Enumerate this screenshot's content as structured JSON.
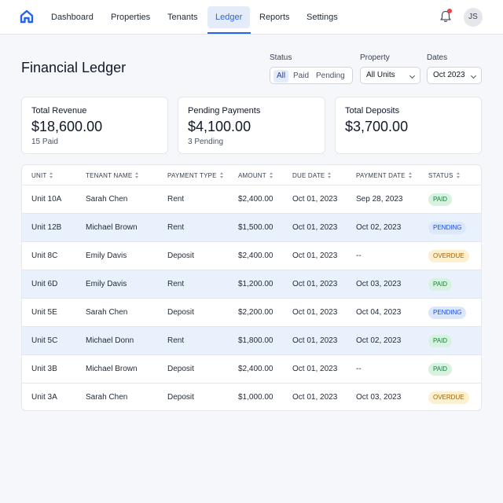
{
  "nav": {
    "items": [
      "Dashboard",
      "Properties",
      "Tenants",
      "Ledger",
      "Reports",
      "Settings"
    ],
    "active": "Ledger",
    "avatar_initials": "JS",
    "accent_color": "#2563eb",
    "icons": [
      "home-logo-icon",
      "bell-icon"
    ]
  },
  "page": {
    "title": "Financial Ledger"
  },
  "filters": {
    "status_label": "Status",
    "status_options": [
      "All",
      "Paid",
      "Pending"
    ],
    "status_selected": "All",
    "property_label": "Property",
    "property_value": "All Units",
    "dates_label": "Dates",
    "dates_value": "Oct 2023"
  },
  "cards": [
    {
      "title": "Total Revenue",
      "value": "$18,600.00",
      "sub": "15 Paid"
    },
    {
      "title": "Pending Payments",
      "value": "$4,100.00",
      "sub": "3 Pending"
    },
    {
      "title": "Total Deposits",
      "value": "$3,700.00",
      "sub": ""
    }
  ],
  "table": {
    "columns": [
      "Unit",
      "Tenant Name",
      "Payment Type",
      "Amount",
      "Due Date",
      "Payment Date",
      "Status"
    ],
    "rows": [
      {
        "unit": "Unit 10A",
        "tenant": "Sarah Chen",
        "type": "Rent",
        "amount": "$2,400.00",
        "due": "Oct 01, 2023",
        "paid": "Sep 28, 2023",
        "status": "PAID",
        "status_kind": "paid"
      },
      {
        "unit": "Unit 12B",
        "tenant": "Michael Brown",
        "type": "Rent",
        "amount": "$1,500.00",
        "due": "Oct 01, 2023",
        "paid": "Oct 02, 2023",
        "status": "PENDING",
        "status_kind": "pending"
      },
      {
        "unit": "Unit 8C",
        "tenant": "Emily Davis",
        "type": "Deposit",
        "amount": "$2,400.00",
        "due": "Oct 01, 2023",
        "paid": "--",
        "status": "OVERDUE",
        "status_kind": "overdue"
      },
      {
        "unit": "Unit 6D",
        "tenant": "Emily Davis",
        "type": "Rent",
        "amount": "$1,200.00",
        "due": "Oct 01, 2023",
        "paid": "Oct 03, 2023",
        "status": "PAID",
        "status_kind": "paid"
      },
      {
        "unit": "Unit 5E",
        "tenant": "Sarah Chen",
        "type": "Deposit",
        "amount": "$2,200.00",
        "due": "Oct 01, 2023",
        "paid": "Oct 04, 2023",
        "status": "PENDING",
        "status_kind": "pending"
      },
      {
        "unit": "Unit 5C",
        "tenant": "Michael Donn",
        "type": "Rent",
        "amount": "$1,800.00",
        "due": "Oct 01, 2023",
        "paid": "Oct 02, 2023",
        "status": "PAID",
        "status_kind": "paid"
      },
      {
        "unit": "Unit 3B",
        "tenant": "Michael Brown",
        "type": "Deposit",
        "amount": "$2,400.00",
        "due": "Oct 01, 2023",
        "paid": "--",
        "status": "PAID",
        "status_kind": "paid"
      },
      {
        "unit": "Unit 3A",
        "tenant": "Sarah Chen",
        "type": "Deposit",
        "amount": "$1,000.00",
        "due": "Oct 01, 2023",
        "paid": "Oct 03, 2023",
        "status": "OVERDUE",
        "status_kind": "overdue"
      }
    ]
  }
}
